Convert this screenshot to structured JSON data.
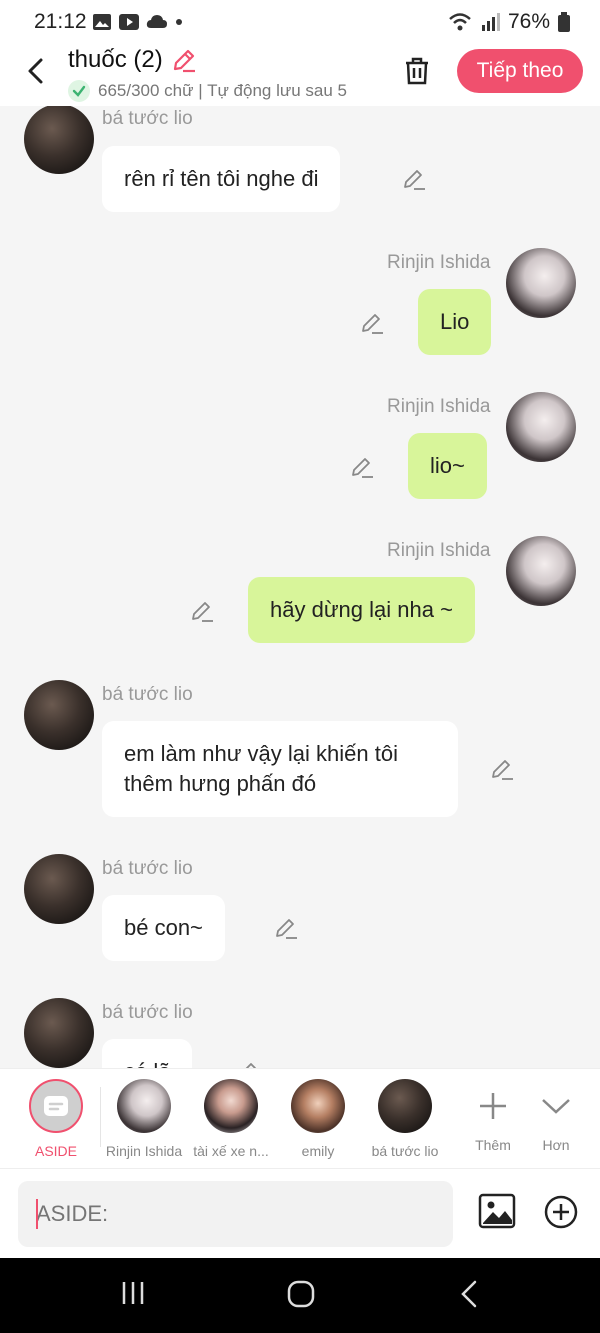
{
  "status": {
    "time": "21:12",
    "battery": "76%"
  },
  "header": {
    "title": "thuốc (2)",
    "subtitle": "665/300 chữ | Tự động lưu sau 5",
    "next_label": "Tiếp theo"
  },
  "messages": [
    {
      "side": "left",
      "sender": "bá tước lio",
      "text": "rên rỉ tên tôi nghe đi"
    },
    {
      "side": "right",
      "sender": "Rinjin Ishida",
      "text": "Lio"
    },
    {
      "side": "right",
      "sender": "Rinjin Ishida",
      "text": "lio~"
    },
    {
      "side": "right",
      "sender": "Rinjin Ishida",
      "text": "hãy dừng lại nha ~"
    },
    {
      "side": "left",
      "sender": "bá tước lio",
      "text": "em làm như vậy lại khiến tôi thêm hưng phấn đó"
    },
    {
      "side": "left",
      "sender": "bá tước lio",
      "text": "bé con~"
    },
    {
      "side": "left",
      "sender": "bá tước lio",
      "text": "có lẽ"
    }
  ],
  "characters": {
    "aside": "ASIDE",
    "items": [
      "Rinjin Ishida",
      "tài xế xe n...",
      "emily",
      "bá tước lio"
    ],
    "more": "Thêm",
    "collapse": "Hơn"
  },
  "input": {
    "placeholder": "ASIDE:"
  },
  "colors": {
    "accent": "#f0506e",
    "own_bubble": "#d8f59a",
    "other_bubble": "#ffffff"
  }
}
